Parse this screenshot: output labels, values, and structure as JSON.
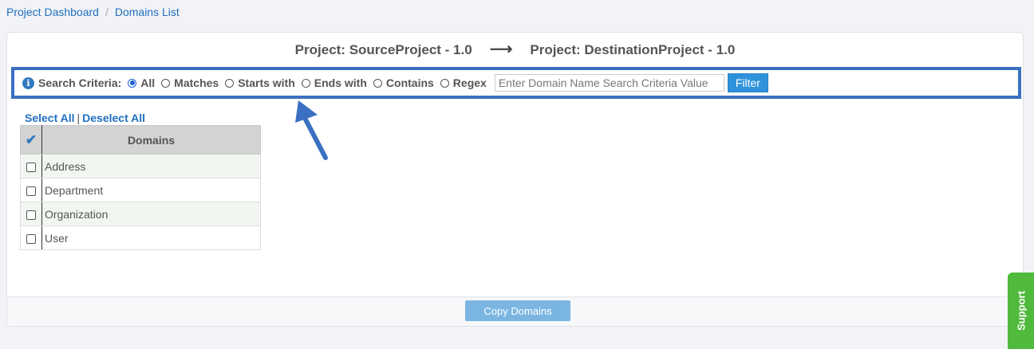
{
  "breadcrumb": {
    "items": [
      "Project Dashboard",
      "Domains List"
    ]
  },
  "header": {
    "source": "Project: SourceProject - 1.0",
    "arrow": "⟶",
    "destination": "Project: DestinationProject - 1.0"
  },
  "search": {
    "label": "Search Criteria:",
    "options": [
      "All",
      "Matches",
      "Starts with",
      "Ends with",
      "Contains",
      "Regex"
    ],
    "selected": "All",
    "placeholder": "Enter Domain Name Search Criteria Value",
    "filter_label": "Filter"
  },
  "selection": {
    "select_all": "Select All",
    "separator": "|",
    "deselect_all": "Deselect All"
  },
  "table": {
    "header": "Domains",
    "rows": [
      "Address",
      "Department",
      "Organization",
      "User"
    ]
  },
  "footer": {
    "copy_label": "Copy Domains"
  },
  "support": {
    "label": "Support"
  },
  "colors": {
    "annotation": "#3a70c1",
    "support_bg": "#4fba3b",
    "filter_bg": "#2f92dc"
  }
}
